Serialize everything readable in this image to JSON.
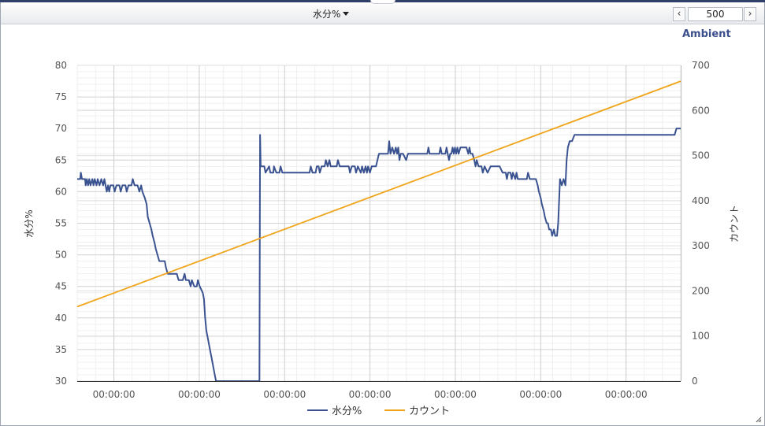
{
  "toolbar": {
    "selector_label": "水分%",
    "page_size": "500",
    "prev_glyph": "‹",
    "next_glyph": "›"
  },
  "brand": {
    "label": "Ambient"
  },
  "chart_data": {
    "type": "line",
    "x_tick_labels": [
      "00:00:00",
      "00:00:00",
      "00:00:00",
      "00:00:00",
      "00:00:00",
      "00:00:00",
      "00:00:00"
    ],
    "x_range": [
      0,
      1000
    ],
    "left_axis": {
      "label": "水分%",
      "ylim": [
        30,
        80
      ],
      "ticks": [
        30,
        35,
        40,
        45,
        50,
        55,
        60,
        65,
        70,
        75,
        80
      ]
    },
    "right_axis": {
      "label": "カウント",
      "ylim": [
        0,
        700
      ],
      "ticks": [
        0,
        100,
        200,
        300,
        400,
        500,
        600,
        700
      ]
    },
    "grid": true,
    "legend_position": "bottom-center",
    "series": [
      {
        "name": "水分%",
        "axis": "left",
        "color": "#3a5390",
        "points": [
          [
            0,
            62
          ],
          [
            5,
            62
          ],
          [
            6,
            63
          ],
          [
            8,
            62
          ],
          [
            13,
            62
          ],
          [
            14,
            61
          ],
          [
            16,
            62
          ],
          [
            18,
            61
          ],
          [
            20,
            62
          ],
          [
            22,
            61
          ],
          [
            25,
            62
          ],
          [
            27,
            61
          ],
          [
            29,
            62
          ],
          [
            32,
            61
          ],
          [
            34,
            62
          ],
          [
            37,
            61
          ],
          [
            40,
            62
          ],
          [
            43,
            61
          ],
          [
            45,
            62
          ],
          [
            47,
            61
          ],
          [
            49,
            60
          ],
          [
            51,
            61
          ],
          [
            53,
            60
          ],
          [
            55,
            61
          ],
          [
            60,
            61
          ],
          [
            62,
            60
          ],
          [
            65,
            61
          ],
          [
            70,
            61
          ],
          [
            72,
            60
          ],
          [
            75,
            61
          ],
          [
            80,
            61
          ],
          [
            82,
            60
          ],
          [
            85,
            61
          ],
          [
            90,
            61
          ],
          [
            92,
            62
          ],
          [
            95,
            61
          ],
          [
            100,
            61
          ],
          [
            103,
            60
          ],
          [
            106,
            61
          ],
          [
            108,
            60
          ],
          [
            112,
            59
          ],
          [
            115,
            58
          ],
          [
            117,
            56
          ],
          [
            120,
            55
          ],
          [
            123,
            54
          ],
          [
            125,
            53
          ],
          [
            128,
            52
          ],
          [
            130,
            51
          ],
          [
            133,
            50
          ],
          [
            136,
            49
          ],
          [
            140,
            49
          ],
          [
            145,
            49
          ],
          [
            147,
            48
          ],
          [
            150,
            47
          ],
          [
            155,
            47
          ],
          [
            160,
            47
          ],
          [
            165,
            47
          ],
          [
            168,
            46
          ],
          [
            175,
            46
          ],
          [
            178,
            47
          ],
          [
            180,
            46
          ],
          [
            185,
            46
          ],
          [
            188,
            45
          ],
          [
            190,
            46
          ],
          [
            194,
            45
          ],
          [
            198,
            45
          ],
          [
            200,
            46
          ],
          [
            203,
            45
          ],
          [
            208,
            44
          ],
          [
            210,
            43
          ],
          [
            212,
            40
          ],
          [
            214,
            38
          ],
          [
            216,
            37
          ],
          [
            218,
            36
          ],
          [
            220,
            35
          ],
          [
            222,
            34
          ],
          [
            224,
            33
          ],
          [
            226,
            32
          ],
          [
            228,
            31
          ],
          [
            230,
            30
          ],
          [
            302,
            30
          ],
          [
            303,
            69
          ],
          [
            304,
            64
          ],
          [
            310,
            64
          ],
          [
            312,
            63
          ],
          [
            318,
            64
          ],
          [
            320,
            63
          ],
          [
            325,
            63
          ],
          [
            326,
            64
          ],
          [
            330,
            63
          ],
          [
            335,
            63
          ],
          [
            337,
            64
          ],
          [
            340,
            63
          ],
          [
            345,
            63
          ],
          [
            350,
            63
          ],
          [
            360,
            63
          ],
          [
            370,
            63
          ],
          [
            385,
            63
          ],
          [
            387,
            64
          ],
          [
            390,
            63
          ],
          [
            395,
            63
          ],
          [
            397,
            64
          ],
          [
            400,
            64
          ],
          [
            402,
            63
          ],
          [
            405,
            64
          ],
          [
            410,
            64
          ],
          [
            412,
            65
          ],
          [
            415,
            64
          ],
          [
            418,
            65
          ],
          [
            420,
            64
          ],
          [
            425,
            64
          ],
          [
            430,
            64
          ],
          [
            432,
            65
          ],
          [
            435,
            64
          ],
          [
            440,
            64
          ],
          [
            450,
            64
          ],
          [
            452,
            63
          ],
          [
            455,
            64
          ],
          [
            460,
            64
          ],
          [
            462,
            63
          ],
          [
            465,
            64
          ],
          [
            470,
            63
          ],
          [
            472,
            64
          ],
          [
            475,
            63
          ],
          [
            478,
            64
          ],
          [
            480,
            63
          ],
          [
            482,
            64
          ],
          [
            485,
            63
          ],
          [
            488,
            64
          ],
          [
            490,
            64
          ],
          [
            495,
            64
          ],
          [
            500,
            66
          ],
          [
            505,
            66
          ],
          [
            510,
            66
          ],
          [
            515,
            66
          ],
          [
            517,
            68
          ],
          [
            519,
            66
          ],
          [
            522,
            67
          ],
          [
            525,
            66
          ],
          [
            528,
            67
          ],
          [
            530,
            66
          ],
          [
            532,
            67
          ],
          [
            534,
            65
          ],
          [
            536,
            66
          ],
          [
            540,
            66
          ],
          [
            545,
            65
          ],
          [
            548,
            66
          ],
          [
            555,
            66
          ],
          [
            560,
            66
          ],
          [
            570,
            66
          ],
          [
            580,
            66
          ],
          [
            582,
            67
          ],
          [
            584,
            66
          ],
          [
            590,
            66
          ],
          [
            600,
            66
          ],
          [
            602,
            67
          ],
          [
            604,
            66
          ],
          [
            610,
            66
          ],
          [
            612,
            67
          ],
          [
            614,
            66
          ],
          [
            616,
            65
          ],
          [
            618,
            66
          ],
          [
            620,
            66
          ],
          [
            622,
            67
          ],
          [
            624,
            66
          ],
          [
            626,
            67
          ],
          [
            628,
            66
          ],
          [
            630,
            67
          ],
          [
            632,
            66
          ],
          [
            635,
            67
          ],
          [
            640,
            67
          ],
          [
            645,
            67
          ],
          [
            648,
            66
          ],
          [
            650,
            67
          ],
          [
            652,
            66
          ],
          [
            655,
            66
          ],
          [
            658,
            65
          ],
          [
            660,
            64
          ],
          [
            662,
            65
          ],
          [
            665,
            64
          ],
          [
            670,
            64
          ],
          [
            672,
            63
          ],
          [
            675,
            64
          ],
          [
            680,
            63
          ],
          [
            685,
            64
          ],
          [
            690,
            64
          ],
          [
            695,
            64
          ],
          [
            700,
            64
          ],
          [
            705,
            63
          ],
          [
            710,
            63
          ],
          [
            712,
            62
          ],
          [
            714,
            63
          ],
          [
            718,
            63
          ],
          [
            720,
            62
          ],
          [
            722,
            63
          ],
          [
            726,
            62
          ],
          [
            728,
            63
          ],
          [
            730,
            62
          ],
          [
            740,
            62
          ],
          [
            745,
            62
          ],
          [
            747,
            63
          ],
          [
            750,
            62
          ],
          [
            755,
            62
          ],
          [
            760,
            62
          ],
          [
            763,
            61
          ],
          [
            765,
            60
          ],
          [
            768,
            59
          ],
          [
            770,
            58
          ],
          [
            773,
            57
          ],
          [
            775,
            56
          ],
          [
            778,
            55
          ],
          [
            780,
            55
          ],
          [
            782,
            54
          ],
          [
            785,
            54
          ],
          [
            787,
            53
          ],
          [
            790,
            54
          ],
          [
            792,
            53
          ],
          [
            795,
            53
          ],
          [
            797,
            55
          ],
          [
            800,
            62
          ],
          [
            803,
            61
          ],
          [
            806,
            62
          ],
          [
            809,
            61
          ],
          [
            811,
            65
          ],
          [
            813,
            67
          ],
          [
            816,
            68
          ],
          [
            820,
            68
          ],
          [
            824,
            69
          ],
          [
            830,
            69
          ],
          [
            840,
            69
          ],
          [
            850,
            69
          ],
          [
            860,
            69
          ],
          [
            870,
            69
          ],
          [
            880,
            69
          ],
          [
            990,
            69
          ],
          [
            993,
            70
          ],
          [
            1000,
            70
          ]
        ]
      },
      {
        "name": "カウント",
        "axis": "right",
        "color": "#f0a418",
        "points": [
          [
            0,
            165
          ],
          [
            1000,
            665
          ]
        ]
      }
    ]
  }
}
